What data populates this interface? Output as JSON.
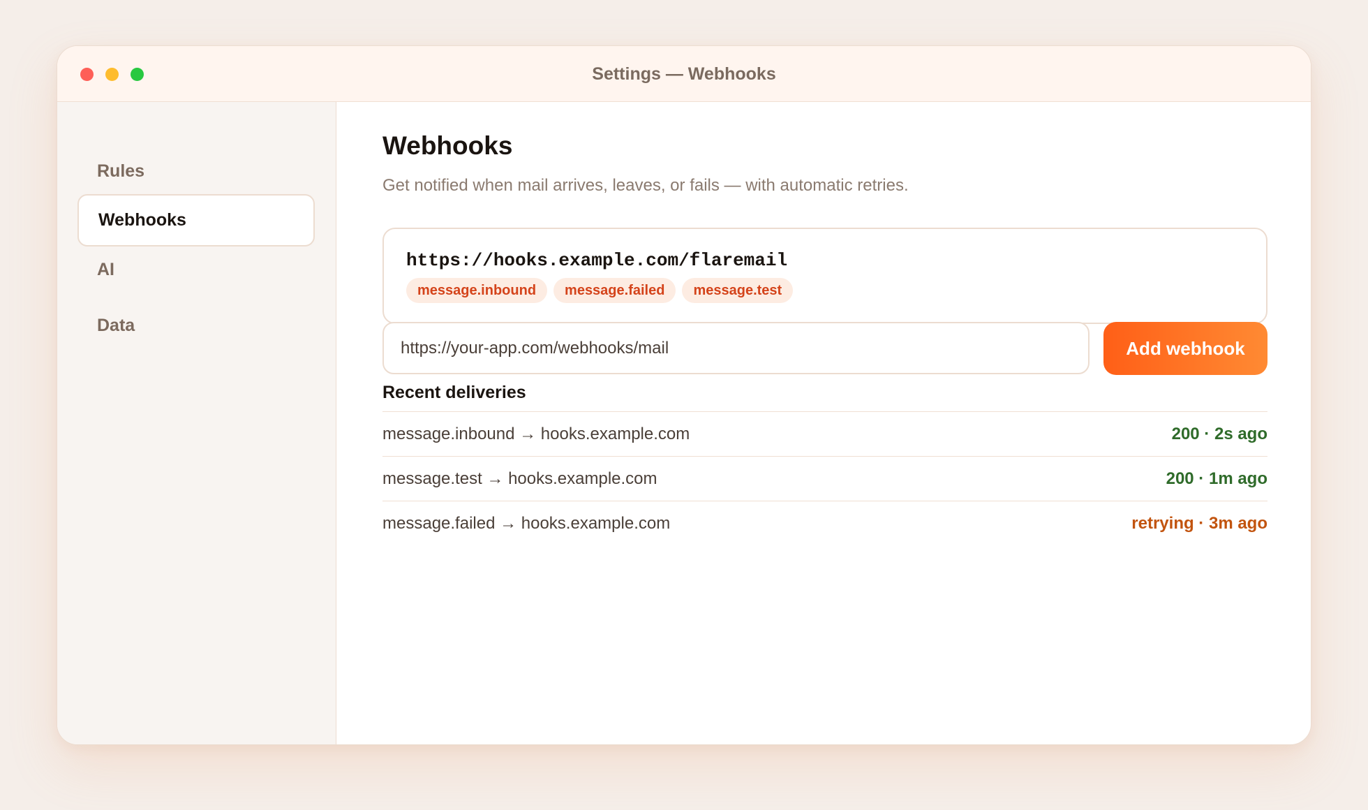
{
  "window": {
    "title": "Settings — Webhooks"
  },
  "sidebar": {
    "items": [
      {
        "label": "Rules",
        "active": false
      },
      {
        "label": "Webhooks",
        "active": true
      },
      {
        "label": "AI",
        "active": false
      },
      {
        "label": "Data",
        "active": false
      }
    ]
  },
  "main": {
    "title": "Webhooks",
    "subtitle": "Get notified when mail arrives, leaves, or fails — with automatic retries.",
    "webhook": {
      "url": "https://hooks.example.com/flaremail",
      "events": [
        "message.inbound",
        "message.failed",
        "message.test"
      ]
    },
    "new_webhook": {
      "value": "https://your-app.com/webhooks/mail",
      "button_label": "Add webhook"
    },
    "deliveries": {
      "title": "Recent deliveries",
      "rows": [
        {
          "text": "message.inbound → hooks.example.com",
          "status": "200 · 2s ago",
          "state": "ok"
        },
        {
          "text": "message.test → hooks.example.com",
          "status": "200 · 1m ago",
          "state": "ok"
        },
        {
          "text": "message.failed → hooks.example.com",
          "status": "retrying · 3m ago",
          "state": "retrying"
        }
      ]
    }
  },
  "colors": {
    "accent": "#ff6a1f",
    "success": "#2f6b2a",
    "warning": "#c2540f",
    "tag_text": "#d4431a"
  }
}
